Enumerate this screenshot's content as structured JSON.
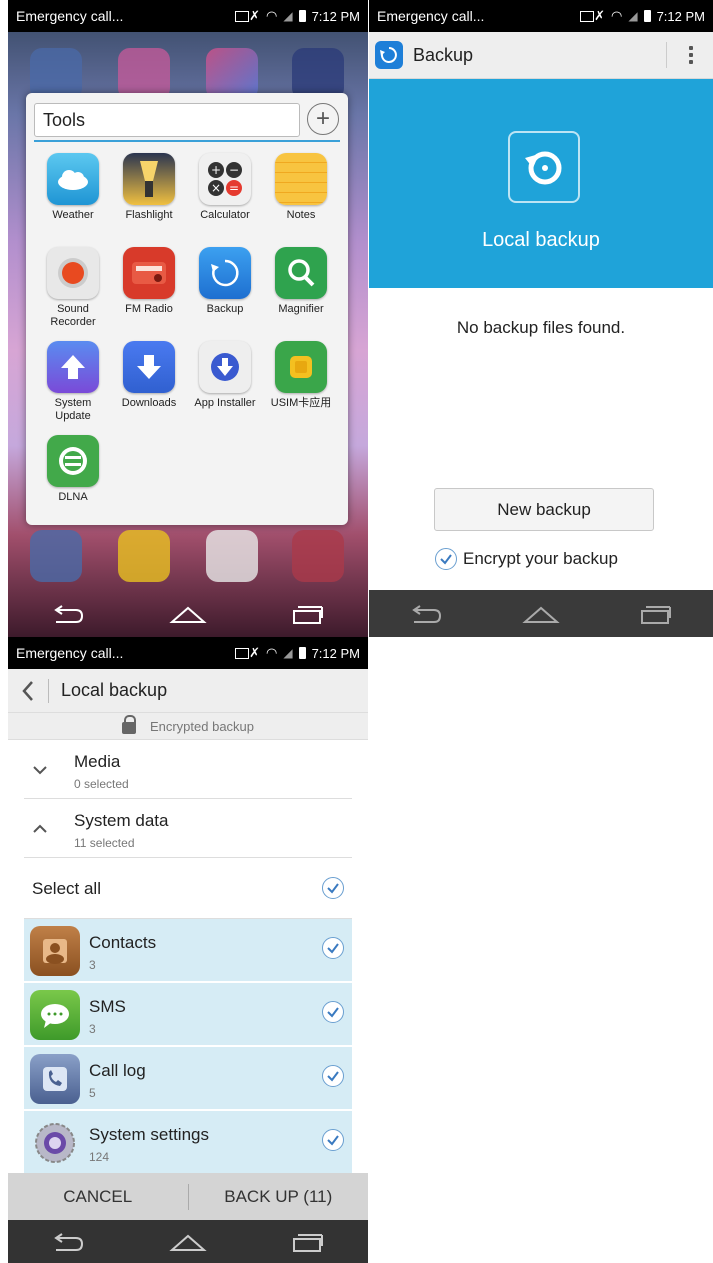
{
  "status_bar": {
    "carrier_text": "Emergency call...",
    "time": "7:12 PM",
    "time_short": "7:12 PM"
  },
  "panel1": {
    "folder_title": "Tools",
    "apps": [
      {
        "label": "Weather",
        "icon": "weather-icon",
        "color": "#3bb6e9"
      },
      {
        "label": "Flashlight",
        "icon": "flashlight-icon",
        "color": "#2b3550"
      },
      {
        "label": "Calculator",
        "icon": "calculator-icon",
        "color": "#eeeeee"
      },
      {
        "label": "Notes",
        "icon": "notes-icon",
        "color": "#f6b830"
      },
      {
        "label": "Sound\nRecorder",
        "icon": "sound-recorder-icon",
        "color": "#e8e8e8"
      },
      {
        "label": "FM Radio",
        "icon": "fm-radio-icon",
        "color": "#d83a2a"
      },
      {
        "label": "Backup",
        "icon": "backup-icon",
        "color": "#1e80db"
      },
      {
        "label": "Magnifier",
        "icon": "magnifier-icon",
        "color": "#2fa34e"
      },
      {
        "label": "System\nUpdate",
        "icon": "system-update-icon",
        "color": "#3a7ee8"
      },
      {
        "label": "Downloads",
        "icon": "downloads-icon",
        "color": "#3a7ee8"
      },
      {
        "label": "App Installer",
        "icon": "app-installer-icon",
        "color": "#eeeeee"
      },
      {
        "label": "USIM卡应用",
        "icon": "usim-icon",
        "color": "#3aa64a"
      },
      {
        "label": "DLNA",
        "icon": "dlna-icon",
        "color": "#42a94a"
      }
    ]
  },
  "panel2": {
    "title": "Backup",
    "hero_label": "Local backup",
    "empty_text": "No backup files found.",
    "new_backup_label": "New backup",
    "encrypt_label": "Encrypt your backup",
    "accent": "#1fa3d9"
  },
  "panel3": {
    "title": "Local backup",
    "encrypted_label": "Encrypted backup",
    "groups": [
      {
        "title": "Media",
        "subtitle": "0 selected"
      },
      {
        "title": "System data",
        "subtitle": "11 selected"
      }
    ],
    "select_all": "Select all",
    "items": [
      {
        "title": "Contacts",
        "count": "3",
        "icon": "contacts-icon"
      },
      {
        "title": "SMS",
        "count": "3",
        "icon": "sms-icon"
      },
      {
        "title": "Call log",
        "count": "5",
        "icon": "call-log-icon"
      },
      {
        "title": "System settings",
        "count": "124",
        "icon": "system-settings-icon"
      }
    ],
    "cancel_label": "CANCEL",
    "backup_label": "BACK UP (11)"
  }
}
